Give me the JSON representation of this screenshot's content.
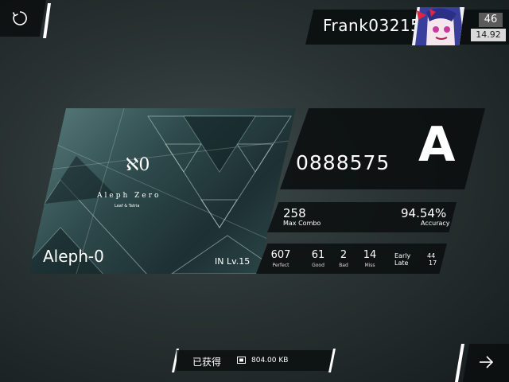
{
  "player": {
    "name": "Frank03215",
    "level": "46",
    "rks": "14.92"
  },
  "song": {
    "title": "Aleph-0",
    "difficulty": "IN Lv.15",
    "art_title": "Aleph Zero",
    "art_subtitle": "Leaf & Tatria",
    "art_glyph": "ℵ0"
  },
  "result": {
    "score": "0888575",
    "grade": "A",
    "max_combo": "258",
    "max_combo_label": "Max Combo",
    "accuracy": "94.54%",
    "accuracy_label": "Accuracy"
  },
  "judgements": {
    "perfect": "607",
    "perfect_label": "Perfect",
    "good": "61",
    "good_label": "Good",
    "bad": "2",
    "bad_label": "Bad",
    "miss": "14",
    "miss_label": "Miss",
    "early_label": "Early",
    "early": "44",
    "late_label": "Late",
    "late": "17"
  },
  "obtained": {
    "label": "已获得",
    "size": "804.00 KB",
    "icon": "data-chip-icon"
  },
  "icons": {
    "retry": "retry-icon",
    "next": "arrow-right-icon"
  }
}
